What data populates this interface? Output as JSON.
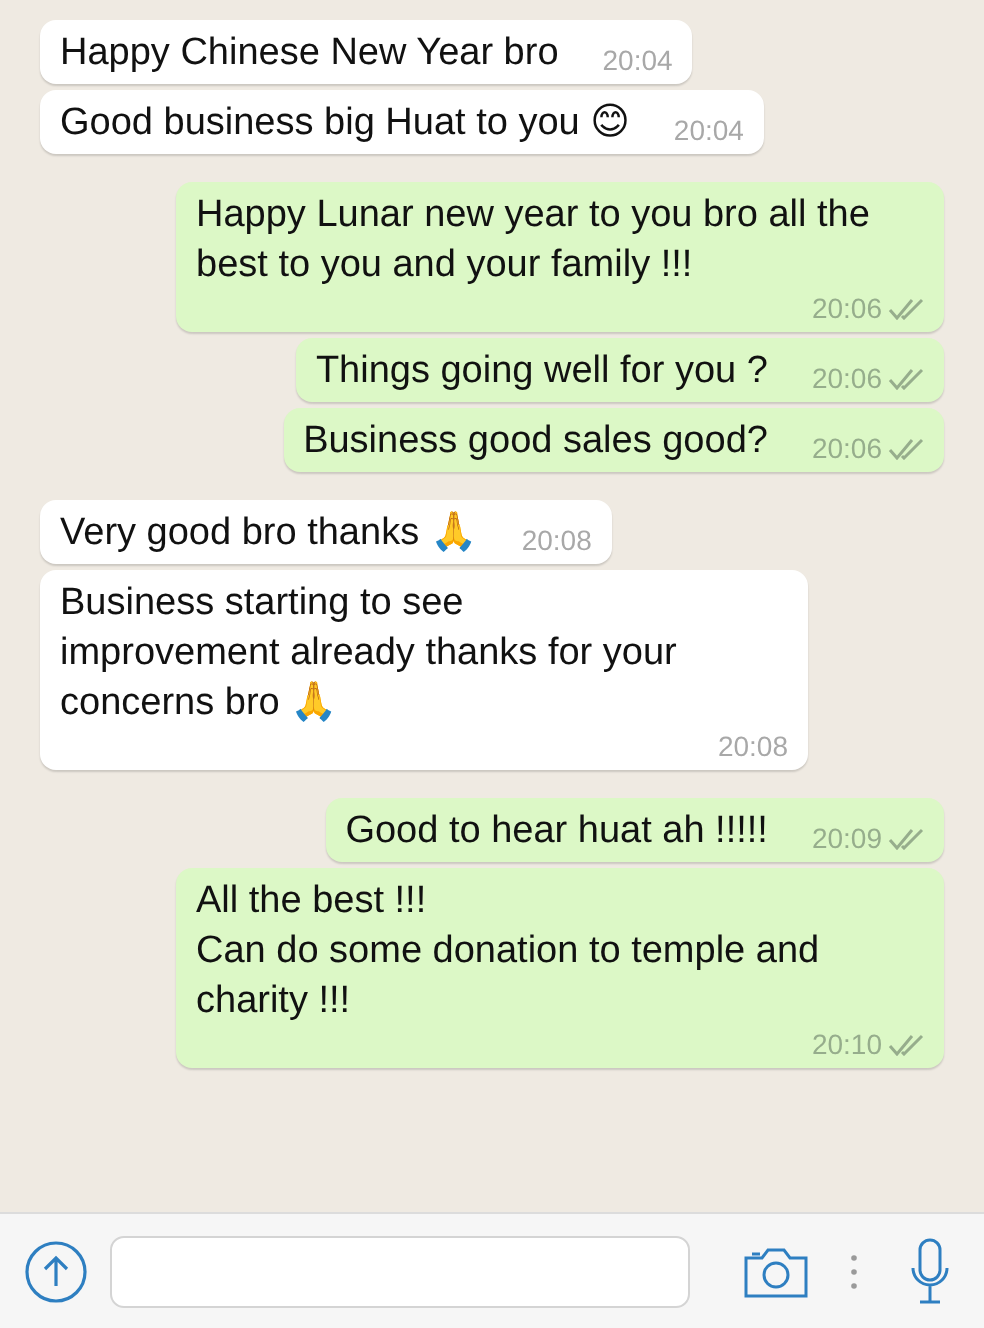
{
  "messages": [
    {
      "outgoing": false,
      "text": "Happy Chinese New Year bro",
      "time": "20:04"
    },
    {
      "outgoing": false,
      "text": "Good business big Huat to you 😊",
      "time": "20:04"
    },
    {
      "outgoing": true,
      "text": "Happy Lunar new year to you bro all the best to you and your family !!!",
      "time": "20:06",
      "delivered": true
    },
    {
      "outgoing": true,
      "text": "Things going well for you ?",
      "time": "20:06",
      "delivered": true
    },
    {
      "outgoing": true,
      "text": "Business good sales good?",
      "time": "20:06",
      "delivered": true
    },
    {
      "outgoing": false,
      "text": "Very good bro thanks 🙏",
      "time": "20:08"
    },
    {
      "outgoing": false,
      "text": "Business starting to see\nimprovement already thanks for your concerns bro 🙏",
      "time": "20:08"
    },
    {
      "outgoing": true,
      "text": "Good to hear huat ah !!!!!",
      "time": "20:09",
      "delivered": true
    },
    {
      "outgoing": true,
      "text": "All the best !!!\nCan do some donation to temple and charity !!!",
      "time": "20:10",
      "delivered": true
    }
  ]
}
